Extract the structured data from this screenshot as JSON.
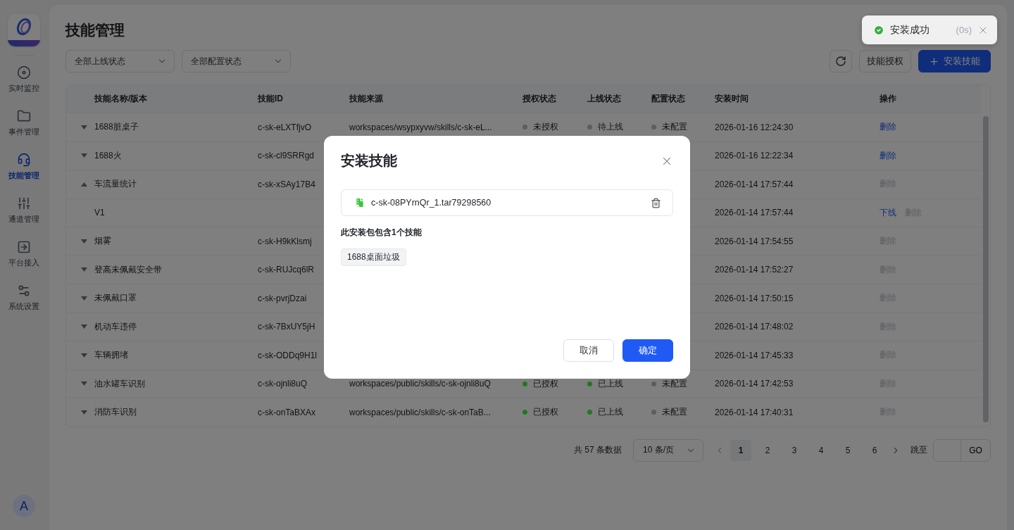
{
  "sidebar": {
    "items": [
      {
        "label": "实时监控",
        "selected": false
      },
      {
        "label": "事件管理",
        "selected": false
      },
      {
        "label": "技能管理",
        "selected": true
      },
      {
        "label": "通道管理",
        "selected": false
      },
      {
        "label": "平台接入",
        "selected": false
      },
      {
        "label": "系统设置",
        "selected": false
      }
    ],
    "avatar": "A"
  },
  "page": {
    "title": "技能管理",
    "filters": [
      {
        "value": "全部上线状态"
      },
      {
        "value": "全部配置状态"
      }
    ],
    "actions": [
      {
        "kind": "icon"
      },
      {
        "kind": "default",
        "label": "技能授权"
      },
      {
        "kind": "primary",
        "label": "安装技能"
      }
    ]
  },
  "table": {
    "columns": [
      "技能名称/版本",
      "技能ID",
      "技能来源",
      "授权状态",
      "上线状态",
      "配置状态",
      "安装时间",
      "操作"
    ],
    "rows": [
      {
        "name": "1688脏桌子",
        "id": "c-sk-eLXTfjvO",
        "source": "workspaces/wsypxyvw/skills/c-sk-eL...",
        "auth": {
          "text": "未授权",
          "color": "#5a5d66"
        },
        "online": {
          "text": "待上线",
          "color": "#5a5d66"
        },
        "config": {
          "text": "未配置",
          "color": "#5a5d66"
        },
        "time": "2026-01-16 12:24:30",
        "expanded": false,
        "ops": [
          {
            "label": "删除",
            "disabled": false
          }
        ]
      },
      {
        "name": "1688火",
        "id": "c-sk-cl9SRRgd",
        "time": "2026-01-16 12:22:34",
        "expanded": false,
        "ops": [
          {
            "label": "删除",
            "disabled": false
          }
        ]
      },
      {
        "name": "车流量统计",
        "id": "c-sk-xSAy17B4",
        "time": "2026-01-14 17:57:44",
        "expanded": true,
        "ops": [
          {
            "label": "删除",
            "disabled": true
          }
        ],
        "children": [
          {
            "name": "V1",
            "time": "2026-01-14 17:57:44",
            "ops": [
              {
                "label": "下线",
                "disabled": false
              },
              {
                "label": "删除",
                "disabled": true
              }
            ]
          }
        ]
      },
      {
        "name": "烟雾",
        "id": "c-sk-H9kKlsmj",
        "time": "2026-01-14 17:54:55",
        "expanded": false,
        "ops": [
          {
            "label": "删除",
            "disabled": true
          }
        ]
      },
      {
        "name": "登高未佩戴安全带",
        "id": "c-sk-RUJcq6lR",
        "time": "2026-01-14 17:52:27",
        "expanded": false,
        "ops": [
          {
            "label": "删除",
            "disabled": true
          }
        ]
      },
      {
        "name": "未佩戴口罩",
        "id": "c-sk-pvrjDzai",
        "time": "2026-01-14 17:50:15",
        "expanded": false,
        "ops": [
          {
            "label": "删除",
            "disabled": true
          }
        ]
      },
      {
        "name": "机动车违停",
        "id": "c-sk-7BxUY5jH",
        "time": "2026-01-14 17:48:02",
        "expanded": false,
        "ops": [
          {
            "label": "删除",
            "disabled": true
          }
        ]
      },
      {
        "name": "车辆拥堵",
        "id": "c-sk-ODDq9H1l",
        "time": "2026-01-14 17:45:33",
        "expanded": false,
        "ops": [
          {
            "label": "删除",
            "disabled": true
          }
        ]
      },
      {
        "name": "油水罐车识别",
        "id": "c-sk-ojnli8uQ",
        "source": "workspaces/public/skills/c-sk-ojnli8uQ",
        "auth": {
          "text": "已授权",
          "color": "#1e7a1e"
        },
        "online": {
          "text": "已上线",
          "color": "#1e7a1e"
        },
        "config": {
          "text": "未配置",
          "color": "#5a5d66"
        },
        "time": "2026-01-14 17:42:53",
        "expanded": false,
        "ops": [
          {
            "label": "删除",
            "disabled": true
          }
        ]
      },
      {
        "name": "消防车识别",
        "id": "c-sk-onTaBXAx",
        "source": "workspaces/public/skills/c-sk-onTaB...",
        "auth": {
          "text": "已授权",
          "color": "#1e7a1e"
        },
        "online": {
          "text": "已上线",
          "color": "#1e7a1e"
        },
        "config": {
          "text": "未配置",
          "color": "#5a5d66"
        },
        "time": "2026-01-14 17:40:31",
        "expanded": false,
        "ops": [
          {
            "label": "删除",
            "disabled": true
          }
        ]
      }
    ]
  },
  "pagination": {
    "total": "共 57 条数据",
    "page_size": "10 条/页",
    "pages": [
      {
        "label": "1",
        "selected": true
      },
      {
        "label": "2",
        "selected": false
      },
      {
        "label": "3",
        "selected": false
      },
      {
        "label": "4",
        "selected": false
      },
      {
        "label": "5",
        "selected": false
      },
      {
        "label": "6",
        "selected": false
      }
    ],
    "jump_label": "跳至",
    "go": "GO"
  },
  "modal": {
    "title": "安装技能",
    "file": {
      "name": "c-sk-08PYrnQr_1.tar79298560"
    },
    "summary": "此安装包包含1个技能",
    "skills": [
      "1688桌面垃圾"
    ],
    "buttons": [
      {
        "label": "取消",
        "kind": "default"
      },
      {
        "label": "确定",
        "kind": "primary"
      }
    ]
  },
  "toast": {
    "message": "安装成功",
    "countdown": "(0s)"
  }
}
